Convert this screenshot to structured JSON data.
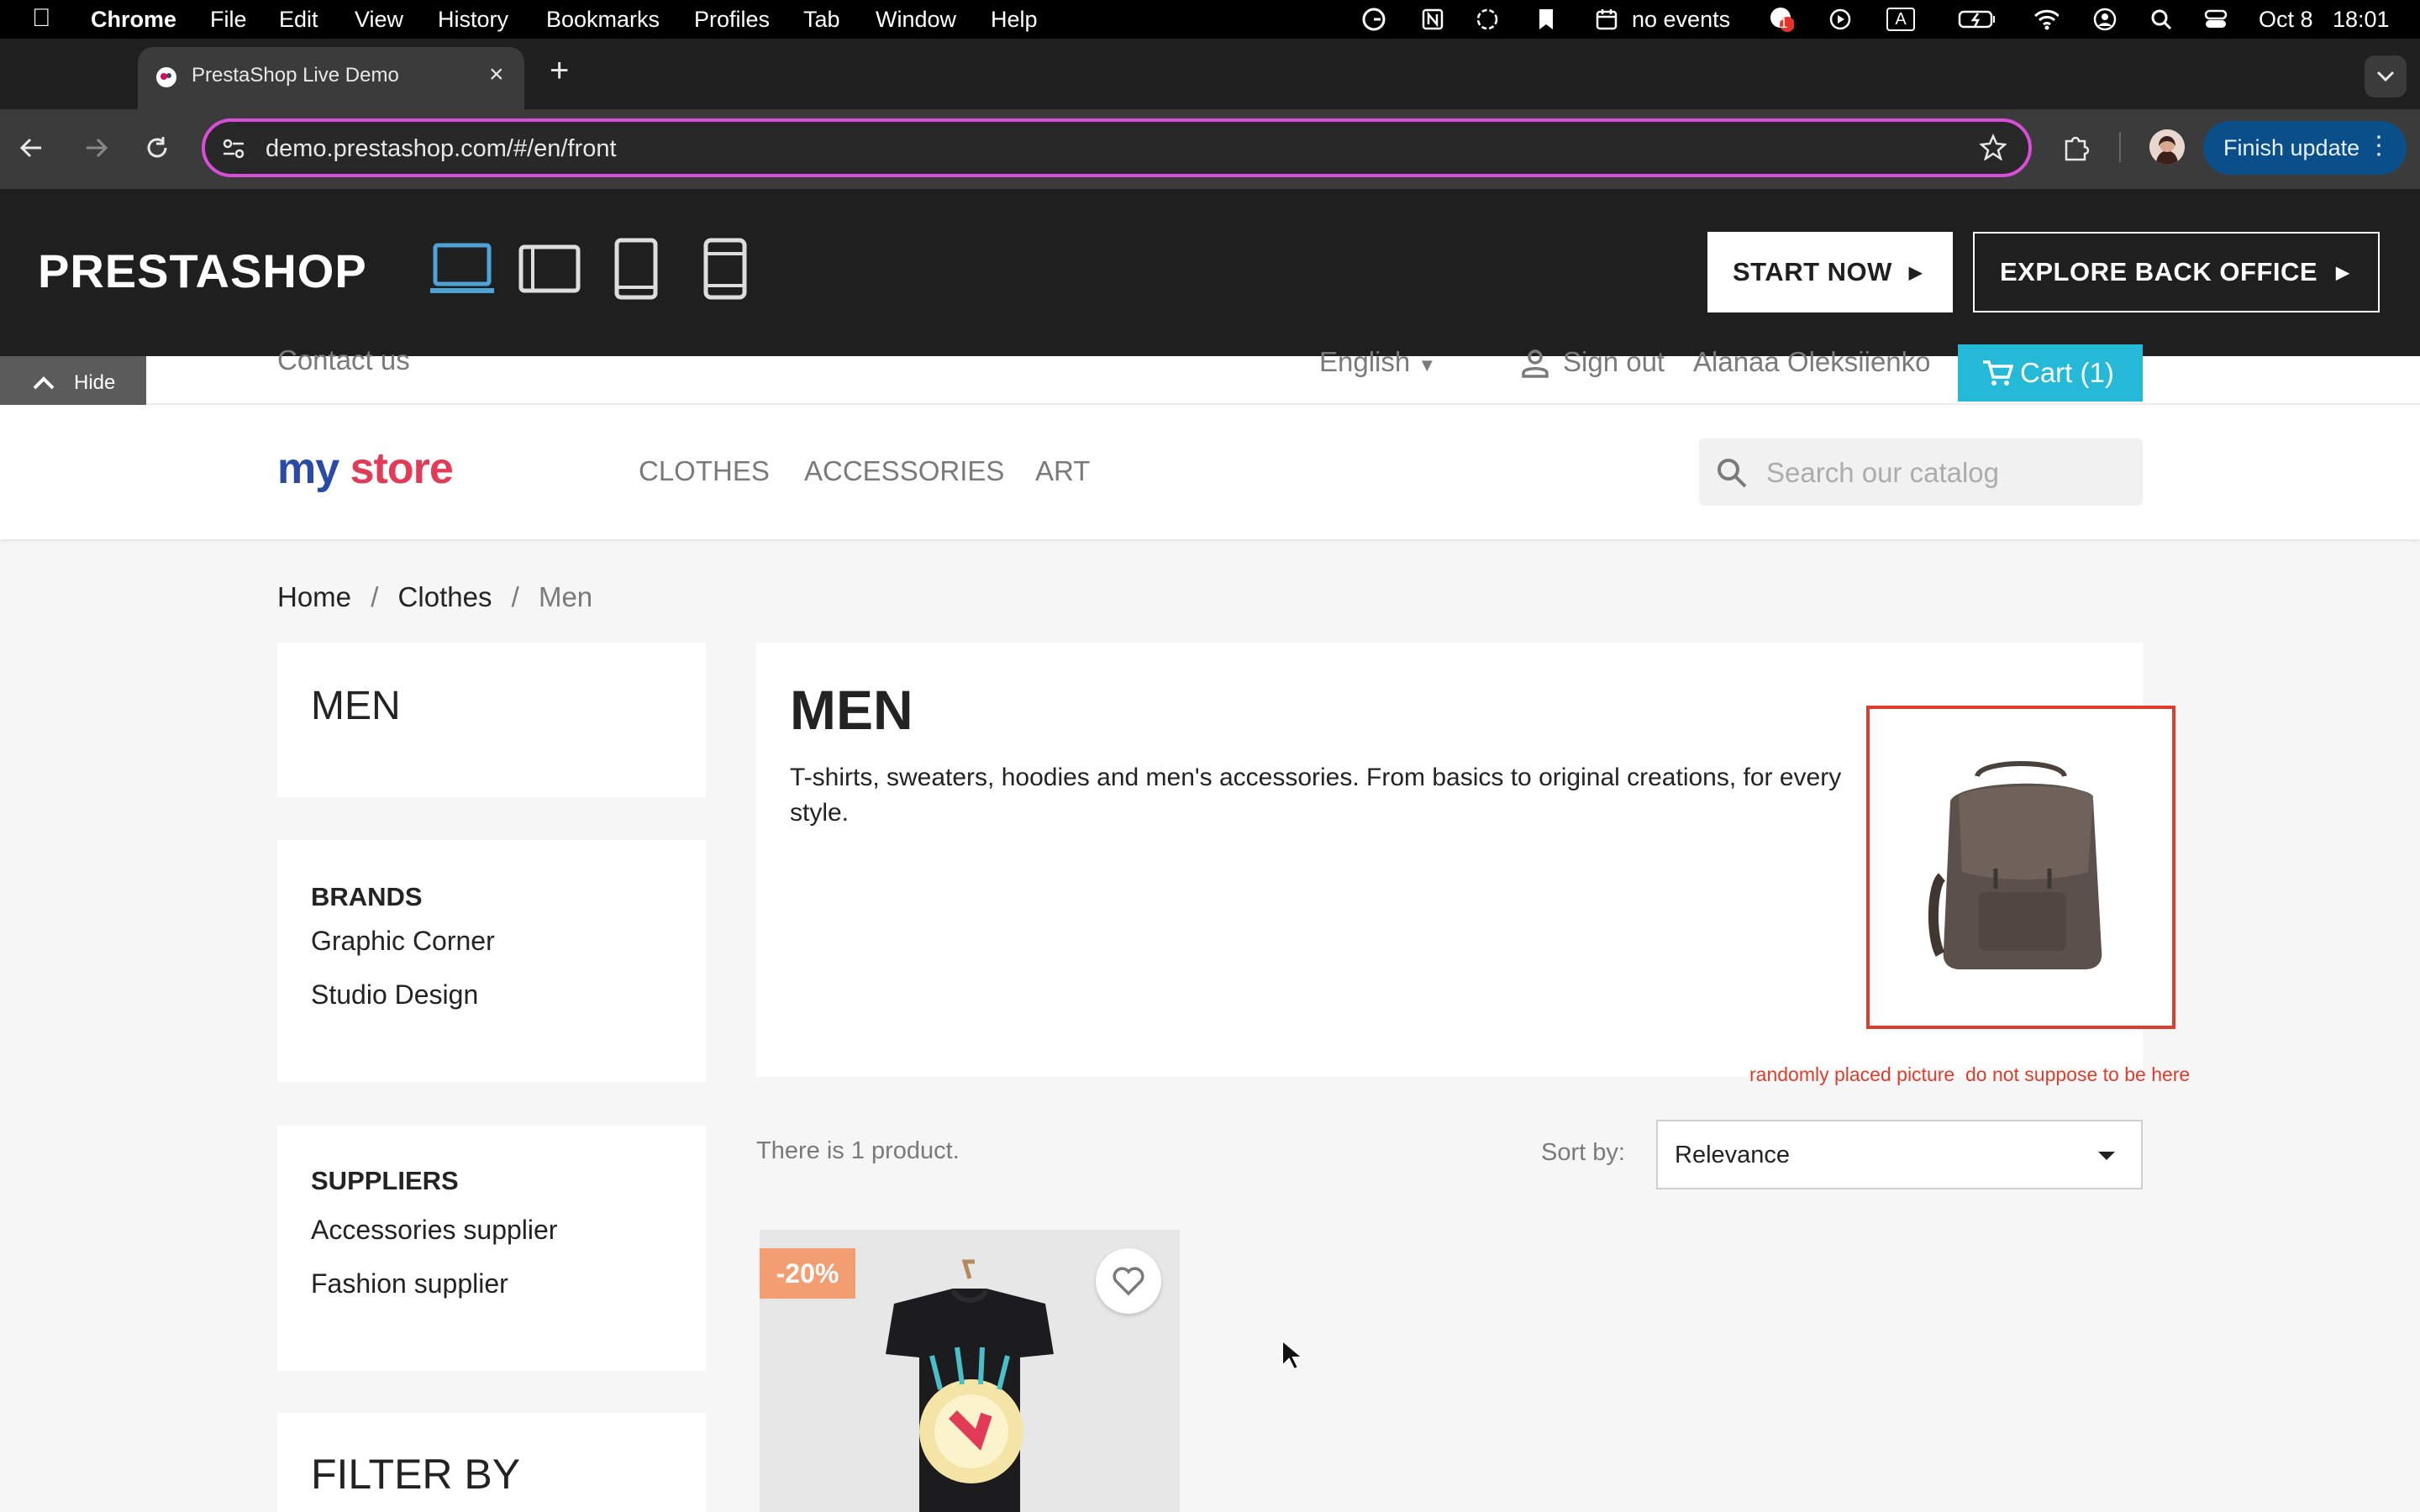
{
  "menubar": {
    "app_name": "Chrome",
    "items": [
      "File",
      "Edit",
      "View",
      "History",
      "Bookmarks",
      "Profiles",
      "Tab",
      "Window",
      "Help"
    ],
    "calendar_text": "no events",
    "notif_count": "1",
    "input_letter": "A",
    "date": "Oct 8",
    "time": "18:01"
  },
  "browser": {
    "tab_title": "PrestaShop Live Demo",
    "url": "demo.prestashop.com/#/en/front",
    "finish_update_label": "Finish update"
  },
  "ps_bar": {
    "logo": "PRESTASHOP",
    "start_now": "START NOW",
    "explore": "EXPLORE BACK OFFICE",
    "hide": "Hide"
  },
  "header": {
    "contact": "Contact us",
    "language": "English",
    "sign_out": "Sign out",
    "user": "Alanaa Oleksiienko",
    "cart": "Cart (1)",
    "logo_a": "my",
    "logo_b": "store",
    "menu": [
      "CLOTHES",
      "ACCESSORIES",
      "ART"
    ],
    "search_placeholder": "Search our catalog"
  },
  "breadcrumb": {
    "home": "Home",
    "clothes": "Clothes",
    "current": "Men"
  },
  "sidebar": {
    "category": "MEN",
    "brands_title": "BRANDS",
    "brands": [
      "Graphic Corner",
      "Studio Design"
    ],
    "suppliers_title": "SUPPLIERS",
    "suppliers": [
      "Accessories supplier",
      "Fashion supplier"
    ],
    "filter_title": "FILTER BY"
  },
  "category": {
    "title": "MEN",
    "description": "T-shirts, sweaters, hoodies and men's accessories. From basics to original creations, for every style.",
    "annotation": "randomly placed picture  do not suppose to be here"
  },
  "listing": {
    "count": "There is 1 product.",
    "sort_label": "Sort by:",
    "sort_value": "Relevance",
    "discount": "-20%"
  },
  "colors": {
    "accent": "#24b9d7",
    "discount": "#f39d72",
    "annotation": "#e03c2c",
    "omnibox_border": "#d94dd9"
  }
}
